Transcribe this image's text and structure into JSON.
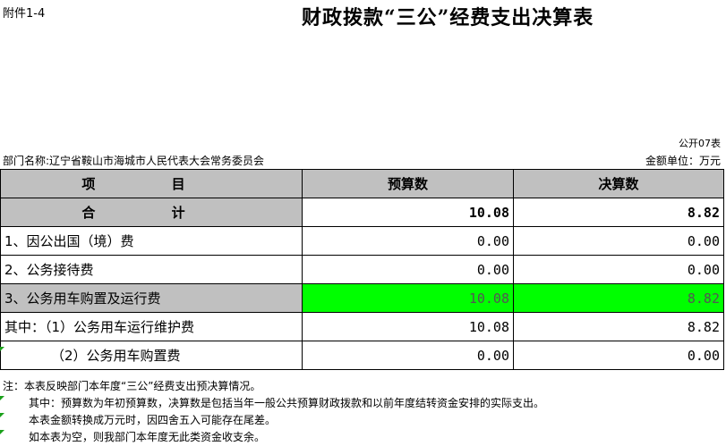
{
  "attachment": "附件1-4",
  "title": "财政拨款“三公”经费支出决算表",
  "form_no": "公开07表",
  "department": "部门名称:辽宁省鞍山市海城市人民代表大会常务委员会",
  "unit": "金额单位：万元",
  "headers": {
    "item": "项 目",
    "budget": "预算数",
    "actual": "决算数"
  },
  "rows": [
    {
      "label": "合 计",
      "budget": "10.08",
      "actual": "8.82"
    },
    {
      "label": "1、因公出国（境）费",
      "budget": "0.00",
      "actual": "0.00"
    },
    {
      "label": "2、公务接待费",
      "budget": "0.00",
      "actual": "0.00"
    },
    {
      "label": "3、公务用车购置及运行费",
      "budget": "10.08",
      "actual": "8.82"
    },
    {
      "label": "其中：（1）公务用车运行维护费",
      "budget": "10.08",
      "actual": "8.82"
    },
    {
      "label": "（2）公务用车购置费",
      "budget": "0.00",
      "actual": "0.00"
    }
  ],
  "notes": [
    "注：本表反映部门本年度“三公”经费支出预决算情况。",
    "其中：预算数为年初预算数，决算数是包括当年一般公共预算财政拨款和以前年度结转资金安排的实际支出。",
    "本表金额转换成万元时，因四舍五入可能存在尾差。",
    "如本表为空，则我部门本年度无此类资金收支余。"
  ],
  "colors": {
    "header_gray": "#c0c0c0",
    "highlight_green": "#00ff00"
  }
}
